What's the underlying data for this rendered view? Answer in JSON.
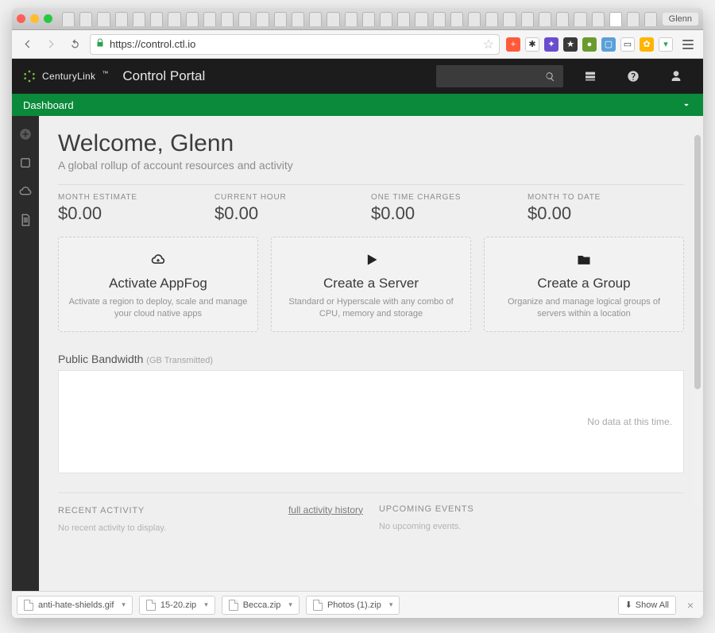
{
  "browser": {
    "profile_name": "Glenn",
    "url": "https://control.ctl.io",
    "ext_colors": [
      "#ff5b3a",
      "#ffffff",
      "#6a4dce",
      "#393939",
      "#6b9b2e",
      "#5aa0d8",
      "#222222",
      "#ffb400",
      "#6cc24a"
    ]
  },
  "header": {
    "brand_name": "CenturyLink",
    "brand_tm": "™",
    "app_title": "Control Portal"
  },
  "breadcrumb": {
    "label": "Dashboard"
  },
  "page": {
    "welcome": "Welcome, Glenn",
    "subtitle": "A global rollup of account resources and activity",
    "stats": [
      {
        "label": "MONTH ESTIMATE",
        "value": "$0.00"
      },
      {
        "label": "CURRENT HOUR",
        "value": "$0.00"
      },
      {
        "label": "ONE TIME CHARGES",
        "value": "$0.00"
      },
      {
        "label": "MONTH TO DATE",
        "value": "$0.00"
      }
    ],
    "actions": [
      {
        "icon": "cloud",
        "title": "Activate AppFog",
        "desc": "Activate a region to deploy, scale and manage your cloud native apps"
      },
      {
        "icon": "play",
        "title": "Create a Server",
        "desc": "Standard or Hyperscale with any combo of CPU, memory and storage"
      },
      {
        "icon": "folder",
        "title": "Create a Group",
        "desc": "Organize and manage logical groups of servers within a location"
      }
    ],
    "bandwidth": {
      "title": "Public Bandwidth",
      "paren": "(GB Transmitted)",
      "nodata": "No data at this time."
    },
    "recent": {
      "title": "RECENT ACTIVITY",
      "history_link": "full activity history",
      "empty": "No recent activity to display."
    },
    "upcoming": {
      "title": "UPCOMING EVENTS",
      "empty": "No upcoming events."
    }
  },
  "downloads": {
    "items": [
      {
        "name": "anti-hate-shields.gif"
      },
      {
        "name": "15-20.zip"
      },
      {
        "name": "Becca.zip"
      },
      {
        "name": "Photos (1).zip"
      }
    ],
    "show_all": "Show All"
  }
}
